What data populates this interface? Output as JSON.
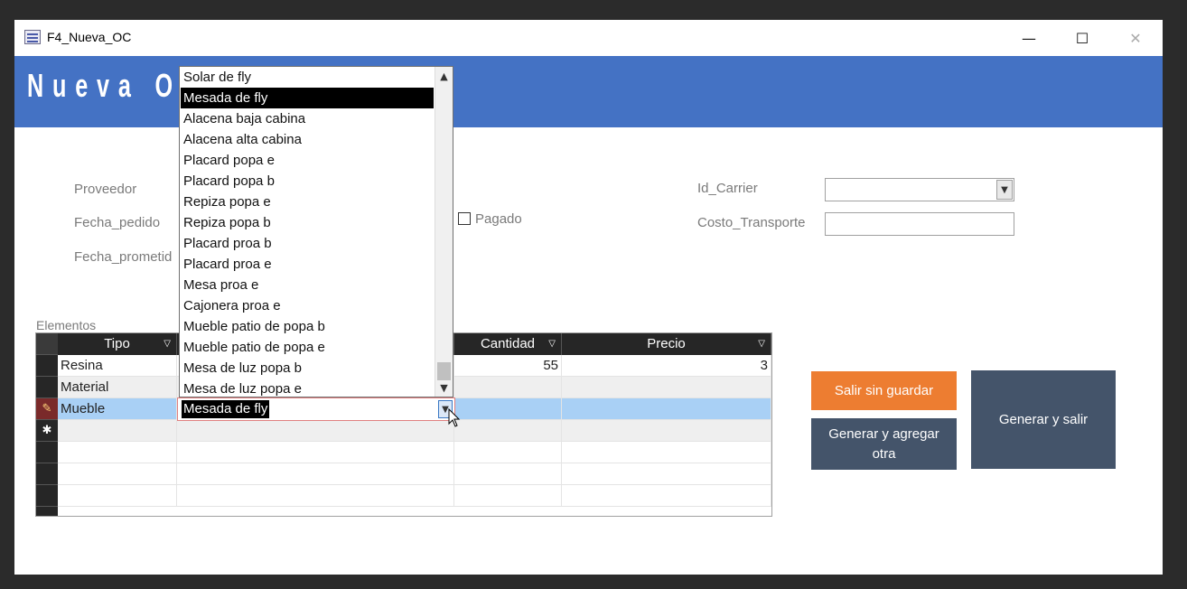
{
  "window": {
    "title": "F4_Nueva_OC",
    "minimize_glyph": "—",
    "maximize_glyph": "☐",
    "close_glyph": "✕"
  },
  "header": {
    "title": "Nueva Or",
    "background_color": "#4472c4"
  },
  "fields": {
    "proveedor_label": "Proveedor",
    "fecha_pedido_label": "Fecha_pedido",
    "fecha_prometida_label": "Fecha_prometid",
    "pagado_label": "Pagado",
    "pagado_checked": false,
    "id_carrier_label": "Id_Carrier",
    "id_carrier_value": "",
    "costo_transporte_label": "Costo_Transporte",
    "costo_transporte_value": ""
  },
  "subform": {
    "label": "Elementos",
    "columns": {
      "tipo": "Tipo",
      "elemento": "",
      "cantidad": "Cantidad",
      "precio": "Precio"
    },
    "rows": [
      {
        "tipo": "Resina",
        "elemento": "",
        "cantidad": "55",
        "precio": "3"
      },
      {
        "tipo": "Material",
        "elemento": "",
        "cantidad": "",
        "precio": ""
      },
      {
        "tipo": "Mueble",
        "elemento": "Mesada de fly",
        "cantidad": "",
        "precio": ""
      }
    ],
    "new_record_glyph": "✱",
    "editing_glyph": "✎"
  },
  "dropdown": {
    "selected": "Mesada de fly",
    "items": [
      "Solar de fly",
      "Mesada de fly",
      "Alacena baja cabina",
      "Alacena alta cabina",
      "Placard popa e",
      "Placard popa b",
      "Repiza popa e",
      "Repiza popa b",
      "Placard proa b",
      "Placard proa e",
      "Mesa proa e",
      "Cajonera proa e",
      "Mueble patio de popa b",
      "Mueble patio de popa e",
      "Mesa de luz popa b",
      "Mesa de luz popa e"
    ]
  },
  "buttons": {
    "salir_sin_guardar": "Salir sin guardar",
    "generar_y_agregar": "Generar y agregar otra",
    "generar_y_salir": "Generar y salir",
    "orange_color": "#ed7d31",
    "slate_color": "#44546a"
  }
}
